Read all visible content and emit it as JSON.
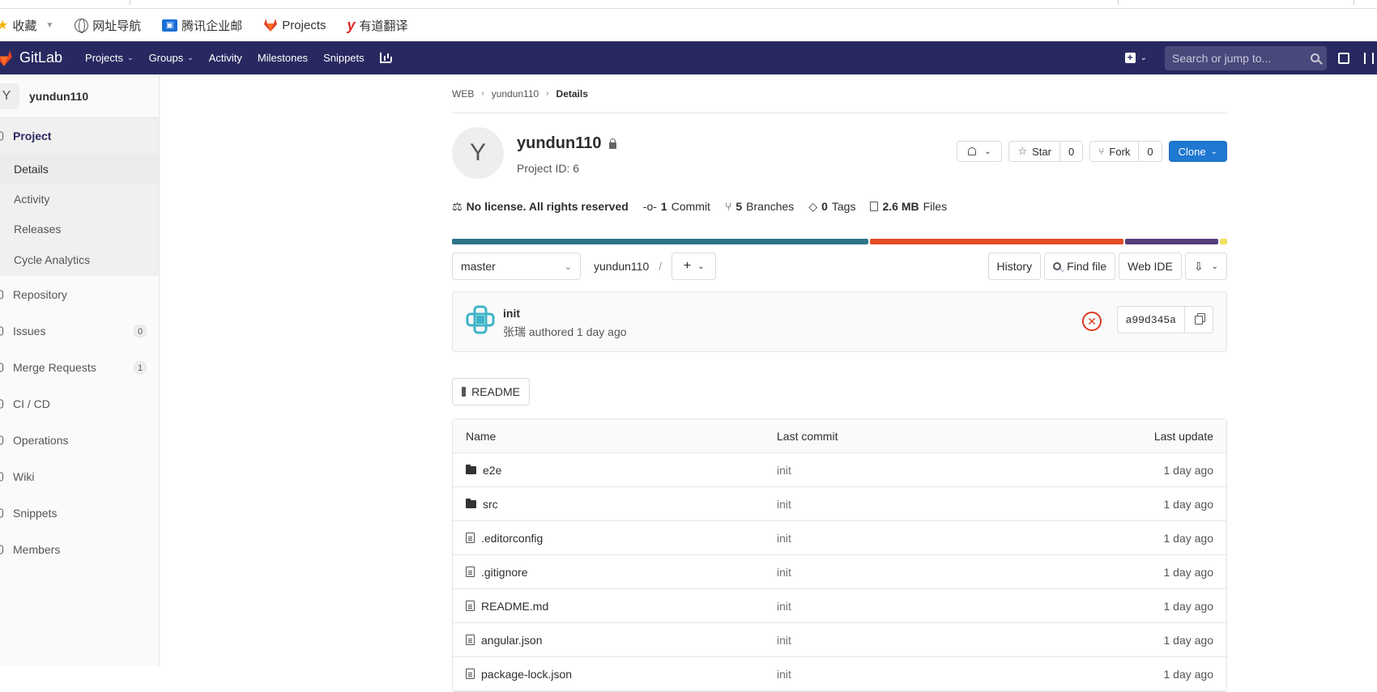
{
  "bookmarks": [
    {
      "label": "收藏",
      "icon": "star-icon"
    },
    {
      "label": "网址导航",
      "icon": "globe-icon"
    },
    {
      "label": "腾讯企业邮",
      "icon": "mail-icon"
    },
    {
      "label": "Projects",
      "icon": "gitlab-fox-icon"
    },
    {
      "label": "有道翻译",
      "icon": "youdao-icon"
    }
  ],
  "navbar": {
    "brand": "GitLab",
    "items": [
      "Projects",
      "Groups",
      "Activity",
      "Milestones",
      "Snippets"
    ],
    "search_placeholder": "Search or jump to..."
  },
  "sidebar": {
    "project_avatar": "Y",
    "project_name": "yundun110",
    "section_label": "Project",
    "sub_items": [
      "Details",
      "Activity",
      "Releases",
      "Cycle Analytics"
    ],
    "items": [
      {
        "label": "Repository",
        "count": ""
      },
      {
        "label": "Issues",
        "count": "0"
      },
      {
        "label": "Merge Requests",
        "count": "1"
      },
      {
        "label": "CI / CD",
        "count": ""
      },
      {
        "label": "Operations",
        "count": ""
      },
      {
        "label": "Wiki",
        "count": ""
      },
      {
        "label": "Snippets",
        "count": ""
      },
      {
        "label": "Members",
        "count": ""
      }
    ]
  },
  "breadcrumb": [
    "WEB",
    "yundun110",
    "Details"
  ],
  "project": {
    "avatar": "Y",
    "name": "yundun110",
    "id_text": "Project ID: 6",
    "star_label": "Star",
    "star_count": "0",
    "fork_label": "Fork",
    "fork_count": "0",
    "clone_label": "Clone"
  },
  "stats": {
    "license": "No license. All rights reserved",
    "commits_num": "1",
    "commits_label": "Commit",
    "branches_num": "5",
    "branches_label": "Branches",
    "tags_num": "0",
    "tags_label": "Tags",
    "files_size": "2.6 MB",
    "files_label": "Files"
  },
  "languages": [
    {
      "color": "#2b7489",
      "share": 0.54
    },
    {
      "color": "#e34c26",
      "share": 0.33
    },
    {
      "color": "#563d7c",
      "share": 0.12
    },
    {
      "color": "#f1e05a",
      "share": 0.01
    }
  ],
  "repo_bar": {
    "branch": "master",
    "path": "yundun110",
    "history": "History",
    "find_file": "Find file",
    "web_ide": "Web IDE"
  },
  "commit": {
    "title": "init",
    "meta": "张瑞 authored 1 day ago",
    "sha": "a99d345a"
  },
  "readme_button": "README",
  "file_tree": {
    "headers": {
      "name": "Name",
      "commit": "Last commit",
      "update": "Last update"
    },
    "rows": [
      {
        "name": "e2e",
        "type": "folder",
        "commit": "init",
        "update": "1 day ago"
      },
      {
        "name": "src",
        "type": "folder",
        "commit": "init",
        "update": "1 day ago"
      },
      {
        "name": ".editorconfig",
        "type": "file",
        "commit": "init",
        "update": "1 day ago"
      },
      {
        "name": ".gitignore",
        "type": "file",
        "commit": "init",
        "update": "1 day ago"
      },
      {
        "name": "README.md",
        "type": "file",
        "commit": "init",
        "update": "1 day ago"
      },
      {
        "name": "angular.json",
        "type": "file",
        "commit": "init",
        "update": "1 day ago"
      },
      {
        "name": "package-lock.json",
        "type": "file",
        "commit": "init",
        "update": "1 day ago"
      }
    ]
  }
}
